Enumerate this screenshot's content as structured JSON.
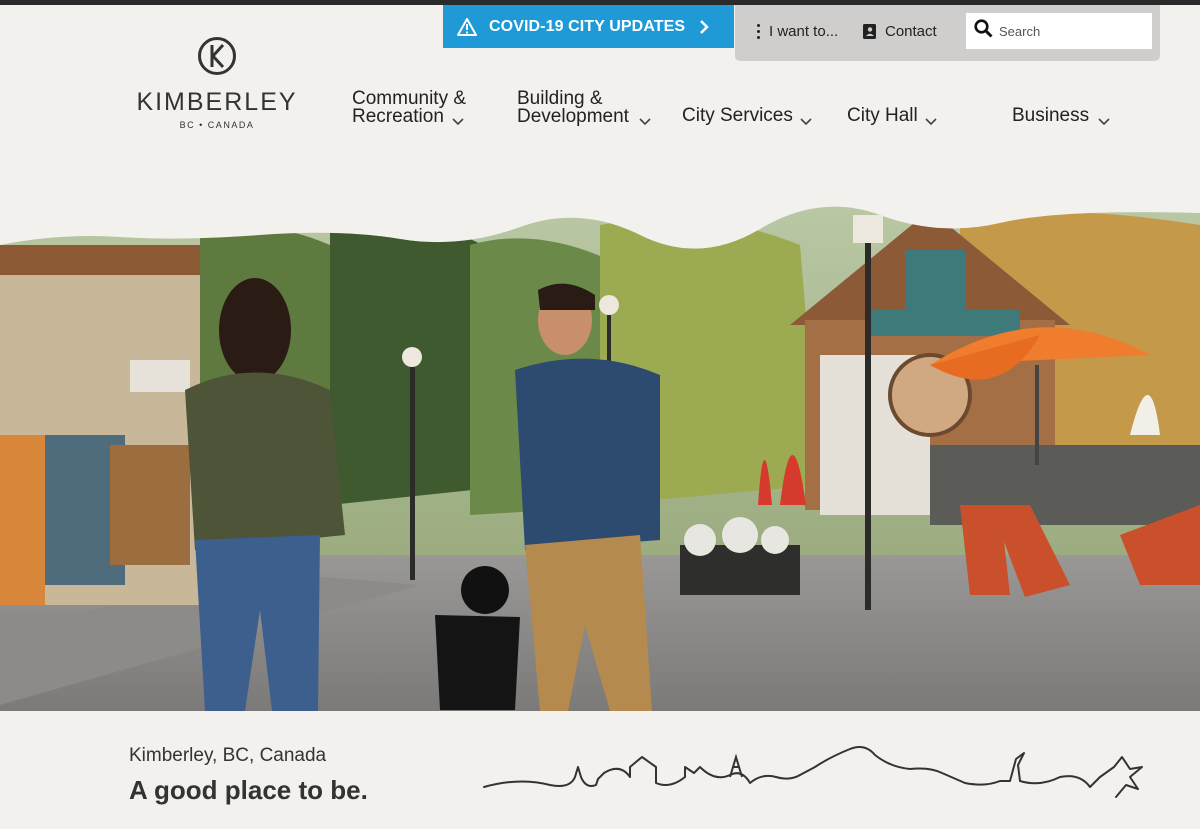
{
  "covid_banner": {
    "label": "COVID-19 CITY UPDATES",
    "color": "#1f9ad6"
  },
  "utility": {
    "i_want": "I want to...",
    "contact": "Contact",
    "search_placeholder": "Search"
  },
  "logo": {
    "name": "KIMBERLEY",
    "sub": "BC • CANADA"
  },
  "nav": {
    "community_line1": "Community &",
    "community_line2": "Recreation",
    "building_line1": "Building &",
    "building_line2": "Development",
    "services": "City Services",
    "cityhall": "City Hall",
    "business": "Business"
  },
  "footer": {
    "location": "Kimberley, BC, Canada",
    "tagline": "A good place to be."
  }
}
